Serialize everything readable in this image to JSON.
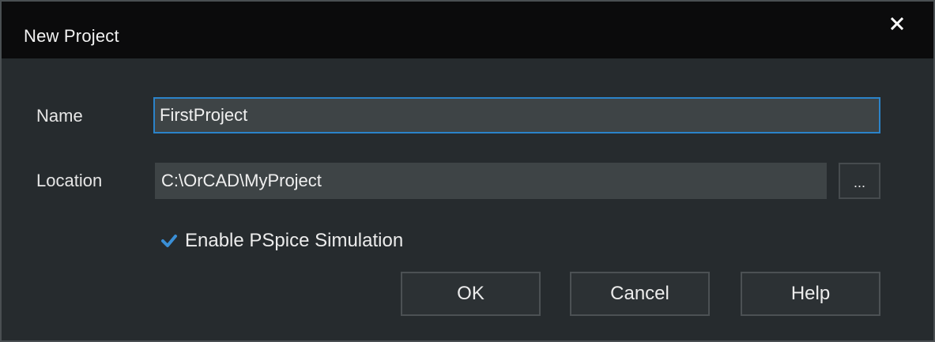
{
  "window": {
    "title": "New Project",
    "close_icon": "close-icon"
  },
  "form": {
    "name_label": "Name",
    "name_value": "FirstProject",
    "location_label": "Location",
    "location_value": "C:\\OrCAD\\MyProject",
    "browse_label": "...",
    "enable_pspice_label": "Enable PSpice Simulation",
    "enable_pspice_checked": true
  },
  "buttons": {
    "ok_label": "OK",
    "cancel_label": "Cancel",
    "help_label": "Help"
  },
  "colors": {
    "titlebar": "#0b0b0c",
    "dialog_background": "#262b2e",
    "focus_border": "#2b83c9",
    "checkbox_accent": "#3a8fd6"
  }
}
